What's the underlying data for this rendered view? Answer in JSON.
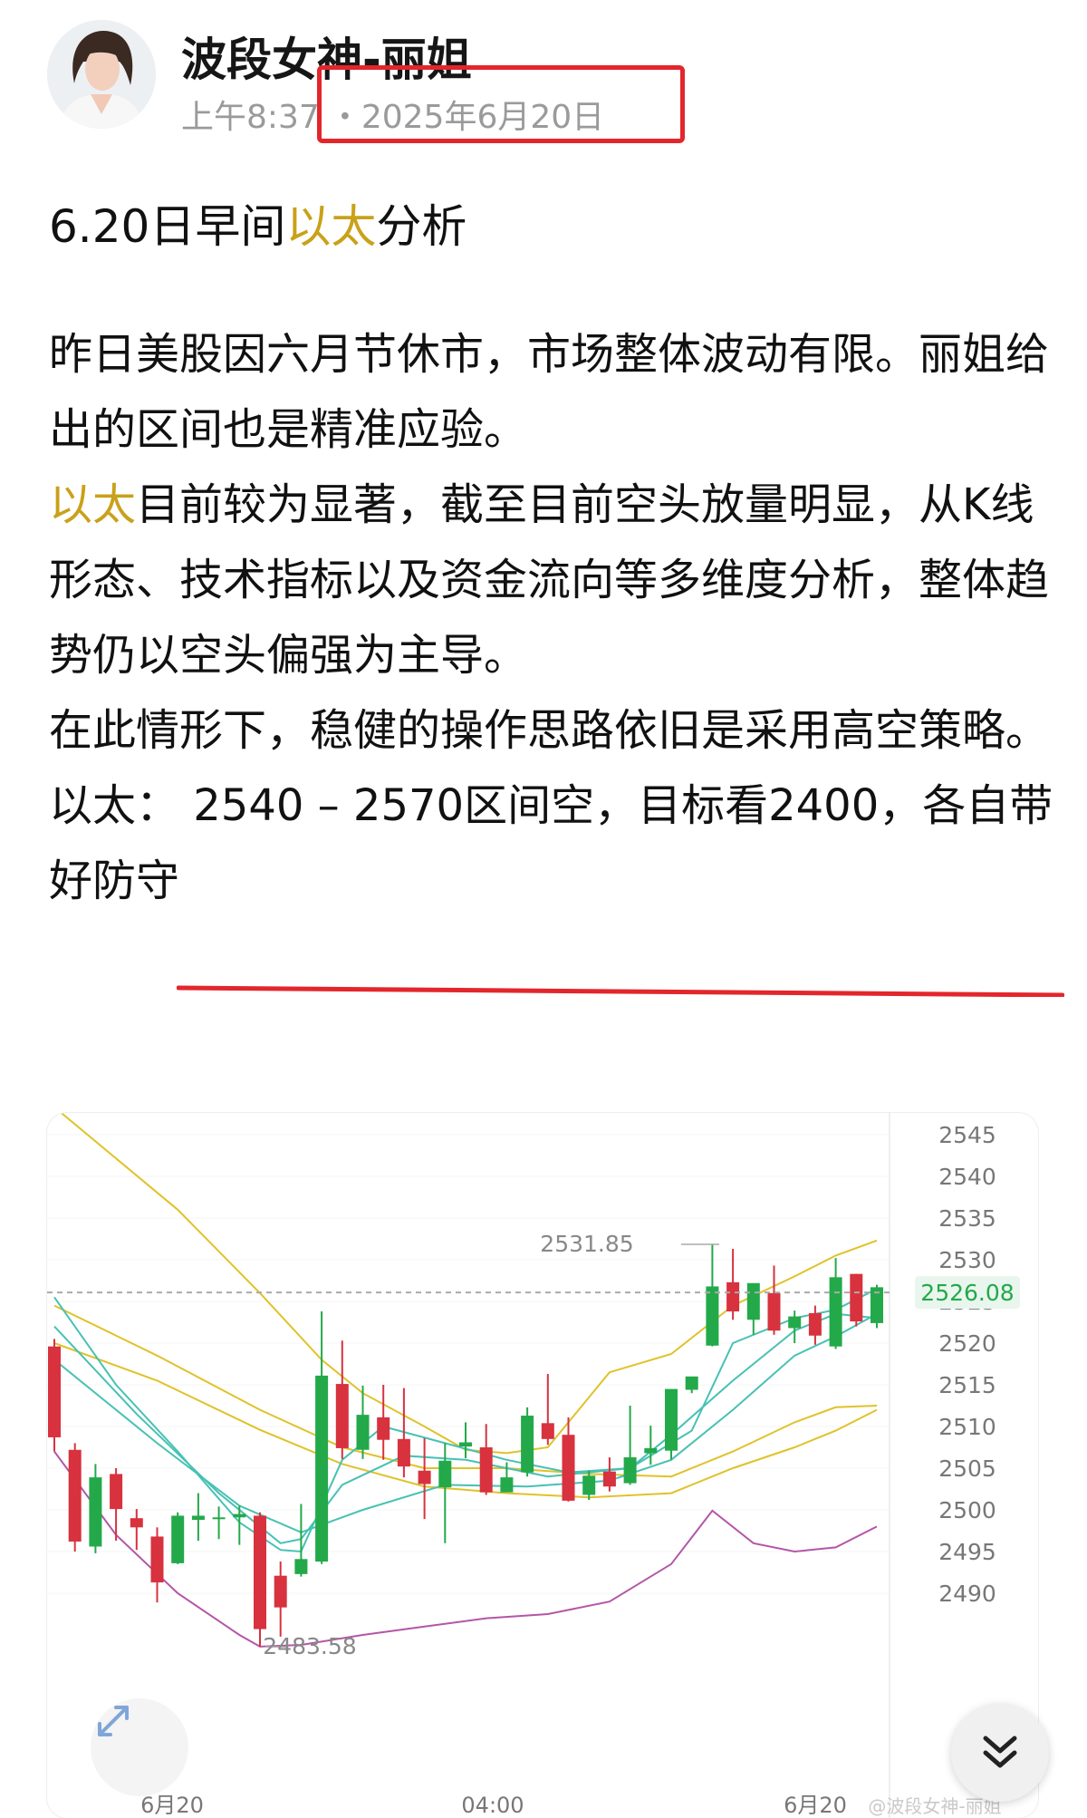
{
  "post": {
    "author": "波段女神-丽姐",
    "time": "上午8:37",
    "date": "・2025年6月20日",
    "title_before": "6.20日早间",
    "title_highlight": "以太",
    "title_after": "分析",
    "paragraphs": [
      {
        "text": "昨日美股因六月节休市，市场整体波动有限。丽姐给出的区间也是精准应验。"
      },
      {
        "highlight": "以太",
        "text": "目前较为显著，截至目前空头放量明显，从K线形态、技术指标以及资金流向等多维度分析，整体趋势仍以空头偏强为主导。"
      },
      {
        "text": "在此情形下，稳健的操作思路依旧是采用高空策略。"
      },
      {
        "text": "以太：  2540 – 2570区间空，目标看2400，各自带好防守"
      }
    ]
  },
  "colors": {
    "highlight": "#c9a11a",
    "annotation_red": "#e3262c",
    "candle_up": "#23a94a",
    "candle_down": "#d7323e",
    "ma_yellow": "#e0c22a",
    "ma_teal": "#47c1b4",
    "ma_purple": "#b456a6"
  },
  "chart_data": {
    "type": "candlestick",
    "y_ticks": [
      "2545",
      "2540",
      "2535",
      "2530",
      "2525",
      "2520",
      "2515",
      "2510",
      "2505",
      "2500",
      "2495",
      "2490"
    ],
    "x_ticks": [
      "6月20",
      "04:00",
      "6月20"
    ],
    "current_price": "2526.08",
    "high_label": "2531.85",
    "low_label": "2483.58",
    "watermark": "@波段女神-丽姐",
    "candles": [
      {
        "o": 2519.6,
        "h": 2520.5,
        "c": 2508.7,
        "l": 2507.0
      },
      {
        "o": 2507.2,
        "h": 2508.0,
        "c": 2496.2,
        "l": 2495.0
      },
      {
        "o": 2495.6,
        "h": 2505.5,
        "c": 2503.9,
        "l": 2494.8
      },
      {
        "o": 2504.3,
        "h": 2505.0,
        "c": 2500.1,
        "l": 2496.3
      },
      {
        "o": 2499.0,
        "h": 2500.1,
        "c": 2497.9,
        "l": 2495.2
      },
      {
        "o": 2496.8,
        "h": 2497.9,
        "c": 2491.3,
        "l": 2488.9
      },
      {
        "o": 2493.6,
        "h": 2499.7,
        "c": 2499.3,
        "l": 2493.5
      },
      {
        "o": 2498.8,
        "h": 2502.0,
        "c": 2499.3,
        "l": 2496.3
      },
      {
        "o": 2499.0,
        "h": 2500.4,
        "c": 2499.1,
        "l": 2496.5
      },
      {
        "o": 2499.1,
        "h": 2500.5,
        "c": 2499.5,
        "l": 2495.8
      },
      {
        "o": 2499.3,
        "h": 2499.7,
        "c": 2485.7,
        "l": 2483.6
      },
      {
        "o": 2492.1,
        "h": 2493.8,
        "c": 2488.3,
        "l": 2484.8
      },
      {
        "o": 2492.3,
        "h": 2500.7,
        "c": 2494.1,
        "l": 2492.0
      },
      {
        "o": 2493.8,
        "h": 2523.8,
        "c": 2516.1,
        "l": 2493.5
      },
      {
        "o": 2515.1,
        "h": 2520.3,
        "c": 2507.4,
        "l": 2506.1
      },
      {
        "o": 2507.2,
        "h": 2514.9,
        "c": 2511.4,
        "l": 2506.1
      },
      {
        "o": 2511.1,
        "h": 2515.0,
        "c": 2508.4,
        "l": 2506.0
      },
      {
        "o": 2508.5,
        "h": 2514.6,
        "c": 2505.2,
        "l": 2503.9
      },
      {
        "o": 2504.7,
        "h": 2508.6,
        "c": 2503.1,
        "l": 2498.9
      },
      {
        "o": 2502.7,
        "h": 2508.0,
        "c": 2505.9,
        "l": 2496.0
      },
      {
        "o": 2507.6,
        "h": 2510.5,
        "c": 2508.1,
        "l": 2506.2
      },
      {
        "o": 2507.5,
        "h": 2510.3,
        "c": 2502.1,
        "l": 2501.8
      },
      {
        "o": 2502.1,
        "h": 2505.7,
        "c": 2503.9,
        "l": 2502.5
      },
      {
        "o": 2504.5,
        "h": 2512.3,
        "c": 2511.3,
        "l": 2504.0
      },
      {
        "o": 2510.4,
        "h": 2516.3,
        "c": 2508.5,
        "l": 2507.8
      },
      {
        "o": 2509.0,
        "h": 2511.1,
        "c": 2501.1,
        "l": 2501.0
      },
      {
        "o": 2501.8,
        "h": 2504.7,
        "c": 2504.1,
        "l": 2501.2
      },
      {
        "o": 2504.6,
        "h": 2506.3,
        "c": 2502.8,
        "l": 2502.2
      },
      {
        "o": 2503.2,
        "h": 2512.5,
        "c": 2506.3,
        "l": 2503.0
      },
      {
        "o": 2506.8,
        "h": 2510.1,
        "c": 2507.4,
        "l": 2505.4
      },
      {
        "o": 2507.1,
        "h": 2513.1,
        "c": 2514.5,
        "l": 2506.0
      },
      {
        "o": 2514.4,
        "h": 2515.0,
        "c": 2516.0,
        "l": 2514.0
      },
      {
        "o": 2519.7,
        "h": 2531.9,
        "c": 2526.8,
        "l": 2519.6
      },
      {
        "o": 2527.3,
        "h": 2531.3,
        "c": 2523.8,
        "l": 2522.8
      },
      {
        "o": 2522.8,
        "h": 2526.1,
        "c": 2527.2,
        "l": 2521.0
      },
      {
        "o": 2526.0,
        "h": 2529.3,
        "c": 2521.5,
        "l": 2521.0
      },
      {
        "o": 2521.8,
        "h": 2523.9,
        "c": 2523.2,
        "l": 2520.0
      },
      {
        "o": 2523.6,
        "h": 2524.5,
        "c": 2520.9,
        "l": 2519.8
      },
      {
        "o": 2519.6,
        "h": 2530.2,
        "c": 2527.9,
        "l": 2519.3
      },
      {
        "o": 2528.3,
        "h": 2528.3,
        "c": 2522.6,
        "l": 2522.0
      },
      {
        "o": 2522.4,
        "h": 2527.0,
        "c": 2526.7,
        "l": 2521.8
      }
    ],
    "lines": [
      {
        "color": "ma_yellow",
        "values": [
          [
            0,
            2548.3
          ],
          [
            6,
            2536.0
          ],
          [
            10,
            2526.0
          ],
          [
            13,
            2518.0
          ],
          [
            15,
            2514.0
          ],
          [
            18,
            2510.0
          ],
          [
            20,
            2507.2
          ],
          [
            22,
            2506.8
          ],
          [
            24,
            2507.5
          ],
          [
            27,
            2516.5
          ],
          [
            30,
            2518.7
          ],
          [
            33,
            2524.5
          ],
          [
            36,
            2528.0
          ],
          [
            38,
            2530.5
          ],
          [
            40,
            2532.3
          ]
        ]
      },
      {
        "color": "ma_yellow",
        "values": [
          [
            0,
            2524.5
          ],
          [
            5,
            2518.5
          ],
          [
            10,
            2512.0
          ],
          [
            14,
            2507.5
          ],
          [
            18,
            2505.0
          ],
          [
            22,
            2505.0
          ],
          [
            26,
            2504.3
          ],
          [
            30,
            2504.0
          ],
          [
            33,
            2507.0
          ],
          [
            36,
            2510.5
          ],
          [
            38,
            2512.3
          ],
          [
            40,
            2512.5
          ]
        ]
      },
      {
        "color": "ma_yellow",
        "values": [
          [
            0,
            2520.0
          ],
          [
            5,
            2515.5
          ],
          [
            10,
            2509.6
          ],
          [
            14,
            2505.5
          ],
          [
            18,
            2502.8
          ],
          [
            22,
            2502.0
          ],
          [
            26,
            2501.5
          ],
          [
            30,
            2502.0
          ],
          [
            33,
            2505.0
          ],
          [
            36,
            2507.5
          ],
          [
            38,
            2509.5
          ],
          [
            40,
            2512.0
          ]
        ]
      },
      {
        "color": "ma_teal",
        "values": [
          [
            0,
            2525.5
          ],
          [
            3,
            2515.0
          ],
          [
            6,
            2507.0
          ],
          [
            9,
            2498.5
          ],
          [
            11,
            2495.2
          ],
          [
            12,
            2495.0
          ],
          [
            14,
            2506.0
          ],
          [
            16,
            2510.0
          ],
          [
            19,
            2508.0
          ],
          [
            22,
            2506.0
          ],
          [
            25,
            2504.5
          ],
          [
            28,
            2505.0
          ],
          [
            31,
            2509.5
          ],
          [
            33,
            2520.0
          ],
          [
            36,
            2523.0
          ],
          [
            38,
            2524.0
          ],
          [
            40,
            2526.5
          ]
        ]
      },
      {
        "color": "ma_teal",
        "values": [
          [
            0,
            2522.0
          ],
          [
            4,
            2511.5
          ],
          [
            8,
            2502.0
          ],
          [
            11,
            2496.0
          ],
          [
            12,
            2496.5
          ],
          [
            14,
            2503.0
          ],
          [
            17,
            2506.5
          ],
          [
            20,
            2506.0
          ],
          [
            24,
            2504.0
          ],
          [
            28,
            2505.0
          ],
          [
            30,
            2509.0
          ],
          [
            33,
            2515.5
          ],
          [
            36,
            2521.5
          ],
          [
            38,
            2523.5
          ],
          [
            40,
            2523.0
          ]
        ]
      },
      {
        "color": "ma_teal",
        "values": [
          [
            0,
            2518.0
          ],
          [
            5,
            2508.0
          ],
          [
            9,
            2500.5
          ],
          [
            12,
            2497.3
          ],
          [
            15,
            2500.0
          ],
          [
            19,
            2503.0
          ],
          [
            23,
            2502.8
          ],
          [
            27,
            2503.5
          ],
          [
            30,
            2506.0
          ],
          [
            33,
            2512.0
          ],
          [
            36,
            2518.5
          ],
          [
            38,
            2520.8
          ],
          [
            40,
            2523.5
          ]
        ]
      },
      {
        "color": "ma_purple",
        "values": [
          [
            0,
            2507.0
          ],
          [
            3,
            2497.0
          ],
          [
            6,
            2490.0
          ],
          [
            9,
            2485.0
          ],
          [
            10,
            2483.6
          ],
          [
            12,
            2483.8
          ],
          [
            15,
            2485.0
          ],
          [
            18,
            2486.0
          ],
          [
            21,
            2487.0
          ],
          [
            24,
            2487.5
          ],
          [
            27,
            2489.0
          ],
          [
            30,
            2493.5
          ],
          [
            32,
            2499.9
          ],
          [
            34,
            2496.0
          ],
          [
            36,
            2495.0
          ],
          [
            38,
            2495.5
          ],
          [
            40,
            2498.0
          ]
        ]
      }
    ]
  }
}
